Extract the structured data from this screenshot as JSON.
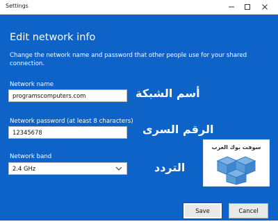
{
  "window": {
    "title": "Settings"
  },
  "dialog": {
    "heading": "Edit network info",
    "description": "Change the network name and password that other people use for your shared connection.",
    "network_name": {
      "label": "Network name",
      "value": "programscomputers.com"
    },
    "network_password": {
      "label": "Network password (at least 8 characters)",
      "value": "12345678"
    },
    "network_band": {
      "label": "Network band",
      "selected": "2.4 GHz"
    },
    "buttons": {
      "save": "Save",
      "cancel": "Cancel"
    }
  },
  "overlay": {
    "arabic_name": "أسم الشبكة",
    "arabic_password": "الرقم السرى",
    "arabic_band": "التردد",
    "logo_text": "سوفت بوك العرب"
  },
  "colors": {
    "dialog_bg": "#0d63c8",
    "button_bg": "#e9e9e9"
  }
}
